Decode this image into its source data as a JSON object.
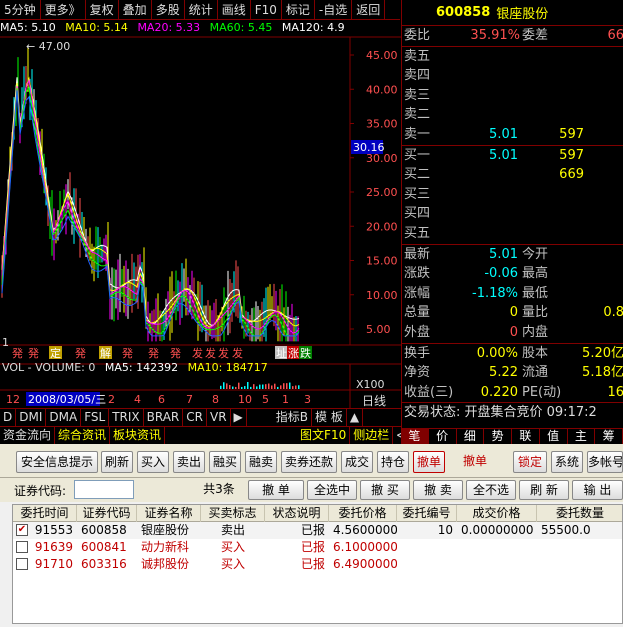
{
  "toolbar": {
    "items": [
      "5分钟",
      "更多》",
      "复权",
      "叠加",
      "多股",
      "统计",
      "画线",
      "F10",
      "标记",
      "-自选",
      "返回"
    ]
  },
  "ma_legend": {
    "ma5": "MA5: 5.10",
    "ma10": "MA10: 5.14",
    "ma20": "MA20: 5.33",
    "ma60": "MA60: 5.45",
    "ma120": "MA120: 4.9",
    "colors": {
      "ma5": "#ffffff",
      "ma10": "#ffff00",
      "ma20": "#ff00ff",
      "ma60": "#00ff00",
      "ma120": "#ffffff"
    }
  },
  "chart": {
    "price_ticks": [
      "45.00",
      "40.00",
      "35.00",
      "30.00",
      "25.00",
      "20.00",
      "15.00",
      "10.00",
      "5.00"
    ],
    "high_label": "47.00",
    "current_price_tag": "30.16",
    "left_label": "1",
    "volume_legend": {
      "vol": "VOL - VOLUME: 0",
      "ma5": "MA5: 142392",
      "ma10": "MA10: 184717"
    },
    "date_label": "2008/03/05/三",
    "date_ticks": [
      "12",
      "2",
      "4",
      "6",
      "7",
      "8",
      "10",
      "5",
      "1",
      "3"
    ],
    "vol_scale": "X100",
    "period_label": "日线",
    "markers": [
      "発",
      "発",
      "定",
      "発",
      "解",
      "発",
      "発",
      "発",
      "发",
      "发",
      "发",
      "发"
    ],
    "end_markers": [
      "址",
      "涨",
      "跌"
    ]
  },
  "indicator_tabs": [
    "D",
    "DMI",
    "DMA",
    "FSL",
    "TRIX",
    "BRAR",
    "CR",
    "VR",
    "▶",
    "指标B",
    "模 板",
    "▲"
  ],
  "sub_tabs": [
    "资金流向",
    "综合资讯",
    "板块资讯",
    "图文F10",
    "侧边栏",
    "≪"
  ],
  "quote": {
    "code": "600858",
    "name": "银座股份",
    "weibi_label": "委比",
    "weibi_value": "35.91%",
    "weicha_label": "委差",
    "weicha_value": "66",
    "sell": [
      {
        "label": "卖五",
        "price": "",
        "vol": ""
      },
      {
        "label": "卖四",
        "price": "",
        "vol": ""
      },
      {
        "label": "卖三",
        "price": "",
        "vol": ""
      },
      {
        "label": "卖二",
        "price": "",
        "vol": ""
      },
      {
        "label": "卖一",
        "price": "5.01",
        "vol": "597"
      }
    ],
    "buy": [
      {
        "label": "买一",
        "price": "5.01",
        "vol": "597"
      },
      {
        "label": "买二",
        "price": "",
        "vol": "669"
      },
      {
        "label": "买三",
        "price": "",
        "vol": ""
      },
      {
        "label": "买四",
        "price": "",
        "vol": ""
      },
      {
        "label": "买五",
        "price": "",
        "vol": ""
      }
    ],
    "stats": [
      {
        "l1": "最新",
        "v1": "5.01",
        "l2": "今开",
        "v2": ""
      },
      {
        "l1": "涨跌",
        "v1": "-0.06",
        "l2": "最高",
        "v2": ""
      },
      {
        "l1": "涨幅",
        "v1": "-1.18%",
        "l2": "最低",
        "v2": ""
      },
      {
        "l1": "总量",
        "v1": "0",
        "l2": "量比",
        "v2": "0.8"
      },
      {
        "l1": "外盘",
        "v1": "0",
        "l2": "内盘",
        "v2": ""
      }
    ],
    "fin": [
      {
        "l1": "换手",
        "v1": "0.00%",
        "l2": "股本",
        "v2": "5.20亿"
      },
      {
        "l1": "净资",
        "v1": "5.22",
        "l2": "流通",
        "v2": "5.18亿"
      },
      {
        "l1": "收益(三)",
        "v1": "0.220",
        "l2": "PE(动)",
        "v2": "16"
      }
    ],
    "status": "交易状态: 开盘集合竞价 09:17:2",
    "tabs": [
      "笔",
      "价",
      "细",
      "势",
      "联",
      "值",
      "主",
      "筹"
    ]
  },
  "trade": {
    "toolbar": [
      "安全信息提示",
      "刷新",
      "买入",
      "卖出",
      "融买",
      "融卖",
      "卖券还款",
      "成交",
      "持仓",
      "撤单",
      "撤单",
      "锁定",
      "系统",
      "多帐号"
    ],
    "code_label": "证券代码:",
    "code_value": "",
    "count_label": "共3条",
    "row2_buttons": [
      "撤 单",
      "全选中",
      "撤 买",
      "撤 卖",
      "全不选",
      "刷 新",
      "输 出"
    ],
    "headers": [
      "委托时间",
      "证券代码",
      "证券名称",
      "买卖标志",
      "状态说明",
      "委托价格",
      "委托编号",
      "成交价格",
      "委托数量"
    ],
    "rows": [
      {
        "checked": true,
        "time": "91553",
        "code": "600858",
        "name": "银座股份",
        "side": "卖出",
        "status": "已报",
        "price": "4.56000000",
        "no": "10",
        "deal": "0.00000000",
        "qty": "55500.0"
      },
      {
        "checked": false,
        "time": "91639",
        "code": "600841",
        "name": "动力新科",
        "side": "买入",
        "status": "已报",
        "price": "6.10000000",
        "no": "",
        "deal": "",
        "qty": ""
      },
      {
        "checked": false,
        "time": "91710",
        "code": "603316",
        "name": "诚邦股份",
        "side": "买入",
        "status": "已报",
        "price": "6.49000000",
        "no": "",
        "deal": "",
        "qty": ""
      }
    ]
  }
}
